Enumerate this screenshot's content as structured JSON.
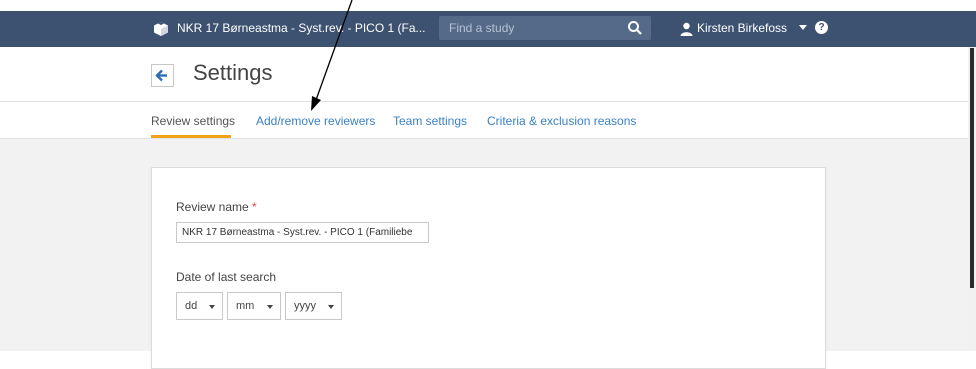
{
  "nav": {
    "title": "NKR 17 Børneastma - Syst.rev. - PICO 1 (Fa...",
    "search_placeholder": "Find a study",
    "user_name": "Kirsten Birkefoss",
    "help_glyph": "?",
    "logo_icon": "cube-logo-icon",
    "bg_color": "#3d5270"
  },
  "header": {
    "title": "Settings",
    "back_icon": "arrow-left-icon"
  },
  "tabs": [
    {
      "label": "Review settings",
      "active": true
    },
    {
      "label": "Add/remove reviewers",
      "active": false
    },
    {
      "label": "Team settings",
      "active": false
    },
    {
      "label": "Criteria & exclusion reasons",
      "active": false
    }
  ],
  "form": {
    "review_name_label": "Review name",
    "required_marker": "*",
    "review_name_value": "NKR 17 Børneastma - Syst.rev. - PICO 1 (Familiebe",
    "date_label": "Date of last search",
    "date_selects": [
      {
        "value": "dd"
      },
      {
        "value": "mm"
      },
      {
        "value": "yyyy"
      }
    ]
  },
  "colors": {
    "accent_underline": "#f0a21b",
    "link": "#3a82c4",
    "required": "#e0463a"
  }
}
